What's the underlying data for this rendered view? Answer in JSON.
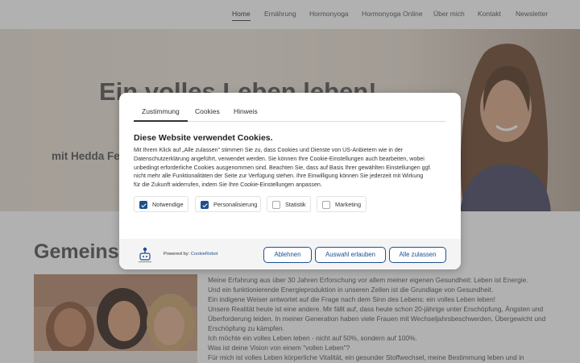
{
  "nav": {
    "items": [
      {
        "label": "Home",
        "active": true
      },
      {
        "label": "Ernährung",
        "active": false
      },
      {
        "label": "Hormonyoga",
        "active": false
      },
      {
        "label": "Hormonyoga Online",
        "active": false
      },
      {
        "label": "Über mich",
        "active": false
      },
      {
        "label": "Kontakt",
        "active": false
      },
      {
        "label": "Newsletter",
        "active": false
      }
    ]
  },
  "hero": {
    "title": "Ein volles Leben leben!",
    "subtitle": "mit Hedda Fe"
  },
  "section": {
    "title": "Gemeinsa",
    "lines": [
      "Meine Erfahrung aus über 30 Jahren Erforschung vor allem meiner eigenen Gesundheit: Leben ist Energie.",
      "Und ein funktionierende Energieproduktion in unseren Zellen ist die Grundlage von Gesundheit.",
      "Ein indigene Weiser antwortet auf die Frage nach dem Sinn des Lebens: ein volles Leben leben!",
      "Unsere Realität heute ist eine andere. Mir fällt auf, dass heute schon 20-jährige unter Erschöpfung, Ängsten und",
      "Überforderung leiden. In meiner Generation haben viele Frauen mit Wechseljahrsbeschwerden, Übergewicht und",
      "Erschöpfung zu kämpfen.",
      "Ich möchte ein volles Leben leben - nicht auf 50%, sondern auf 100%.",
      "Was ist deine Vision von einem \"vollen Leben\"?",
      "Für mich ist volles Leben körperliche Vitalität, ein gesunder Stoffwechsel, meine Bestimmung leben und in"
    ]
  },
  "consent": {
    "tabs": [
      {
        "label": "Zustimmung",
        "active": true
      },
      {
        "label": "Cookies",
        "active": false
      },
      {
        "label": "Hinweis",
        "active": false
      }
    ],
    "heading": "Diese Website verwendet Cookies.",
    "text_lines": [
      "Mit Ihrem Klick auf „Alle zulassen\" stimmen Sie zu, dass Cookies und Dienste von US-Anbietern wie in der",
      "Datenschutzerklärung angeführt, verwendet werden. Sie können Ihre Cookie-Einstellungen auch bearbeiten, wobei",
      "unbedingt erforderliche Cookies ausgenommen sind. Beachten Sie, dass auf Basis Ihrer gewählten Einstellungen ggf.",
      "nicht mehr alle Funktionalitäten der Seite zur Verfügung stehen. Ihre Einwilligung können Sie jederzeit mit Wirkung",
      "für die Zukunft widerrufen, indem Sie Ihre Cookie-Einstellungen anpassen."
    ],
    "categories": [
      {
        "label": "Notwendige",
        "checked": true
      },
      {
        "label": "Personalisierung",
        "checked": true
      },
      {
        "label": "Statistik",
        "checked": false
      },
      {
        "label": "Marketing",
        "checked": false
      }
    ],
    "powered_prefix": "Powered by:",
    "powered_link": "CookieRobot",
    "buttons": {
      "reject": "Ablehnen",
      "select": "Auswahl erlauben",
      "accept": "Alle zulassen"
    },
    "accent_color": "#1e4f8c"
  }
}
